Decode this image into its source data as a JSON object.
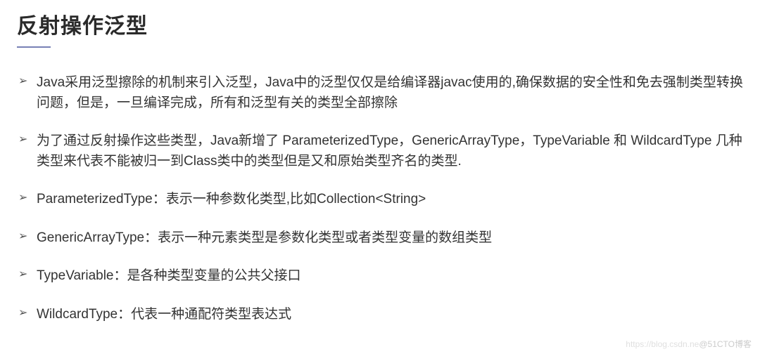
{
  "title": "反射操作泛型",
  "bullets": [
    "Java采用泛型擦除的机制来引入泛型，Java中的泛型仅仅是给编译器javac使用的,确保数据的安全性和免去强制类型转换问题，但是，一旦编译完成，所有和泛型有关的类型全部擦除",
    "为了通过反射操作这些类型，Java新增了 ParameterizedType，GenericArrayType，TypeVariable 和 WildcardType 几种类型来代表不能被归一到Class类中的类型但是又和原始类型齐名的类型.",
    "ParameterizedType：表示一种参数化类型,比如Collection<String>",
    "GenericArrayType：表示一种元素类型是参数化类型或者类型变量的数组类型",
    "TypeVariable：是各种类型变量的公共父接口",
    "WildcardType：代表一种通配符类型表达式"
  ],
  "watermark": {
    "faded": "https://blog.csdn.ne",
    "main": "@51CTO博客"
  }
}
